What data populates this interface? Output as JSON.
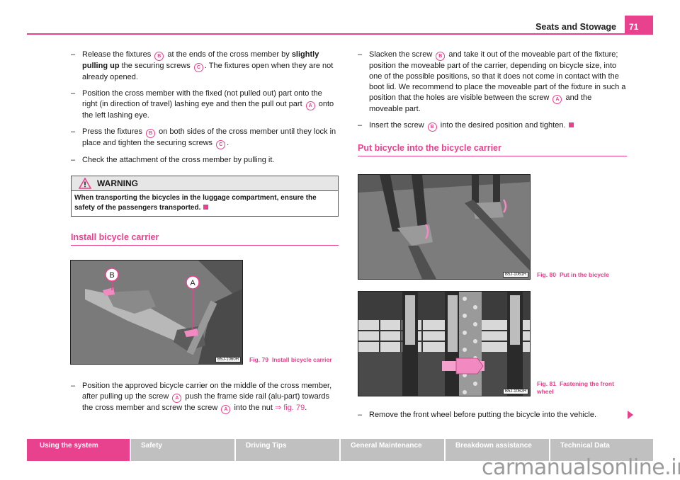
{
  "header": {
    "title": "Seats and Stowage",
    "page_number": "71",
    "accent_color": "#e8418d"
  },
  "left_column": {
    "steps": [
      {
        "parts": [
          "Release the fixtures ",
          "B",
          " at the ends of the cross member by ",
          "slightly pulling up",
          " the securing screws ",
          "C",
          ". The fixtures open when they are not already opened."
        ]
      },
      {
        "parts": [
          "Position the cross member with the fixed (not pulled out) part onto the right (in direction of travel) lashing eye and then the pull out part ",
          "A",
          " onto the left lashing eye."
        ]
      },
      {
        "parts": [
          "Press the fixtures ",
          "B",
          " on both sides of the cross member until they lock in place and tighten the securing screws ",
          "C",
          "."
        ]
      },
      {
        "parts": [
          "Check the attachment of the cross member by pulling it."
        ]
      }
    ],
    "warning": {
      "title": "WARNING",
      "text": "When transporting the bicycles in the luggage compartment, ensure the safety of the passengers transported."
    },
    "section_title": "Install bicycle carrier",
    "figure": {
      "code": "B5J-1060H",
      "caption_num": "Fig. 79",
      "caption_text": "Install bicycle carrier",
      "labels": [
        "B",
        "A"
      ]
    },
    "install_step": {
      "parts": [
        "Position the approved bicycle carrier on the middle of the cross member, after pulling up the screw ",
        "A",
        " push the frame side rail (alu-part) towards the cross member and screw the screw ",
        "A",
        " into the nut "
      ],
      "link": "⇒ fig. 79",
      "end": "."
    }
  },
  "right_column": {
    "steps": [
      {
        "parts": [
          "Slacken the screw ",
          "B",
          " and take it out of the moveable part of the fixture; position the moveable part of the carrier, depending on bicycle size, into one of the possible positions, so that it does not come in contact with the boot lid. We recommend to place the moveable part of the fixture in such a position that the holes are visible between the screw ",
          "A",
          " and the moveable part."
        ]
      },
      {
        "parts": [
          "Insert the screw ",
          "B",
          " into the desired position and tighten."
        ]
      }
    ],
    "section_title": "Put bicycle into the bicycle carrier",
    "figures": [
      {
        "code": "B5J-1061H",
        "caption_num": "Fig. 80",
        "caption_text": "Put in the bicycle"
      },
      {
        "code": "B5J-1062H",
        "caption_num": "Fig. 81",
        "caption_text": "Fastening the front wheel"
      }
    ],
    "final_step": "Remove the front wheel before putting the bicycle into the vehicle."
  },
  "nav_tabs": [
    {
      "label": "Using the system",
      "active": true
    },
    {
      "label": "Safety",
      "active": false
    },
    {
      "label": "Driving Tips",
      "active": false
    },
    {
      "label": "General Maintenance",
      "active": false
    },
    {
      "label": "Breakdown assistance",
      "active": false
    },
    {
      "label": "Technical Data",
      "active": false
    }
  ],
  "watermark": "carmanualsonline.info"
}
